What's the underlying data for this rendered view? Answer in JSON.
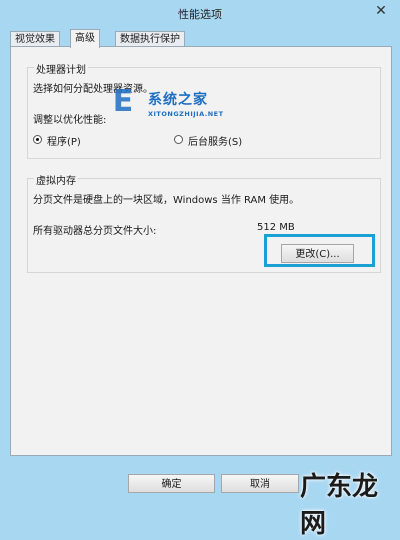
{
  "window": {
    "title": "性能选项",
    "close_glyph": "✕"
  },
  "tabs": [
    {
      "label": "视觉效果",
      "active": false
    },
    {
      "label": "高级",
      "active": true
    },
    {
      "label": "数据执行保护",
      "active": false
    }
  ],
  "processor": {
    "title": "处理器计划",
    "description": "选择如何分配处理器资源。",
    "adjust_label": "调整以优化性能:",
    "options": [
      {
        "label": "程序(P)",
        "selected": true
      },
      {
        "label": "后台服务(S)",
        "selected": false
      }
    ]
  },
  "virtual_memory": {
    "title": "虚拟内存",
    "description": "分页文件是硬盘上的一块区域，Windows 当作 RAM 使用。",
    "total_label": "所有驱动器总分页文件大小:",
    "total_value": "512 MB",
    "change_button": "更改(C)..."
  },
  "footer": {
    "ok": "确定",
    "cancel": "取消"
  },
  "watermarks": {
    "site1_logo": "E",
    "site1_name": "系统之家",
    "site1_sub": "XITONGZHIJIA.NET",
    "site2": "广东龙网"
  },
  "colors": {
    "highlight": "#19a1d6",
    "window_bg": "#a8d7f2"
  }
}
